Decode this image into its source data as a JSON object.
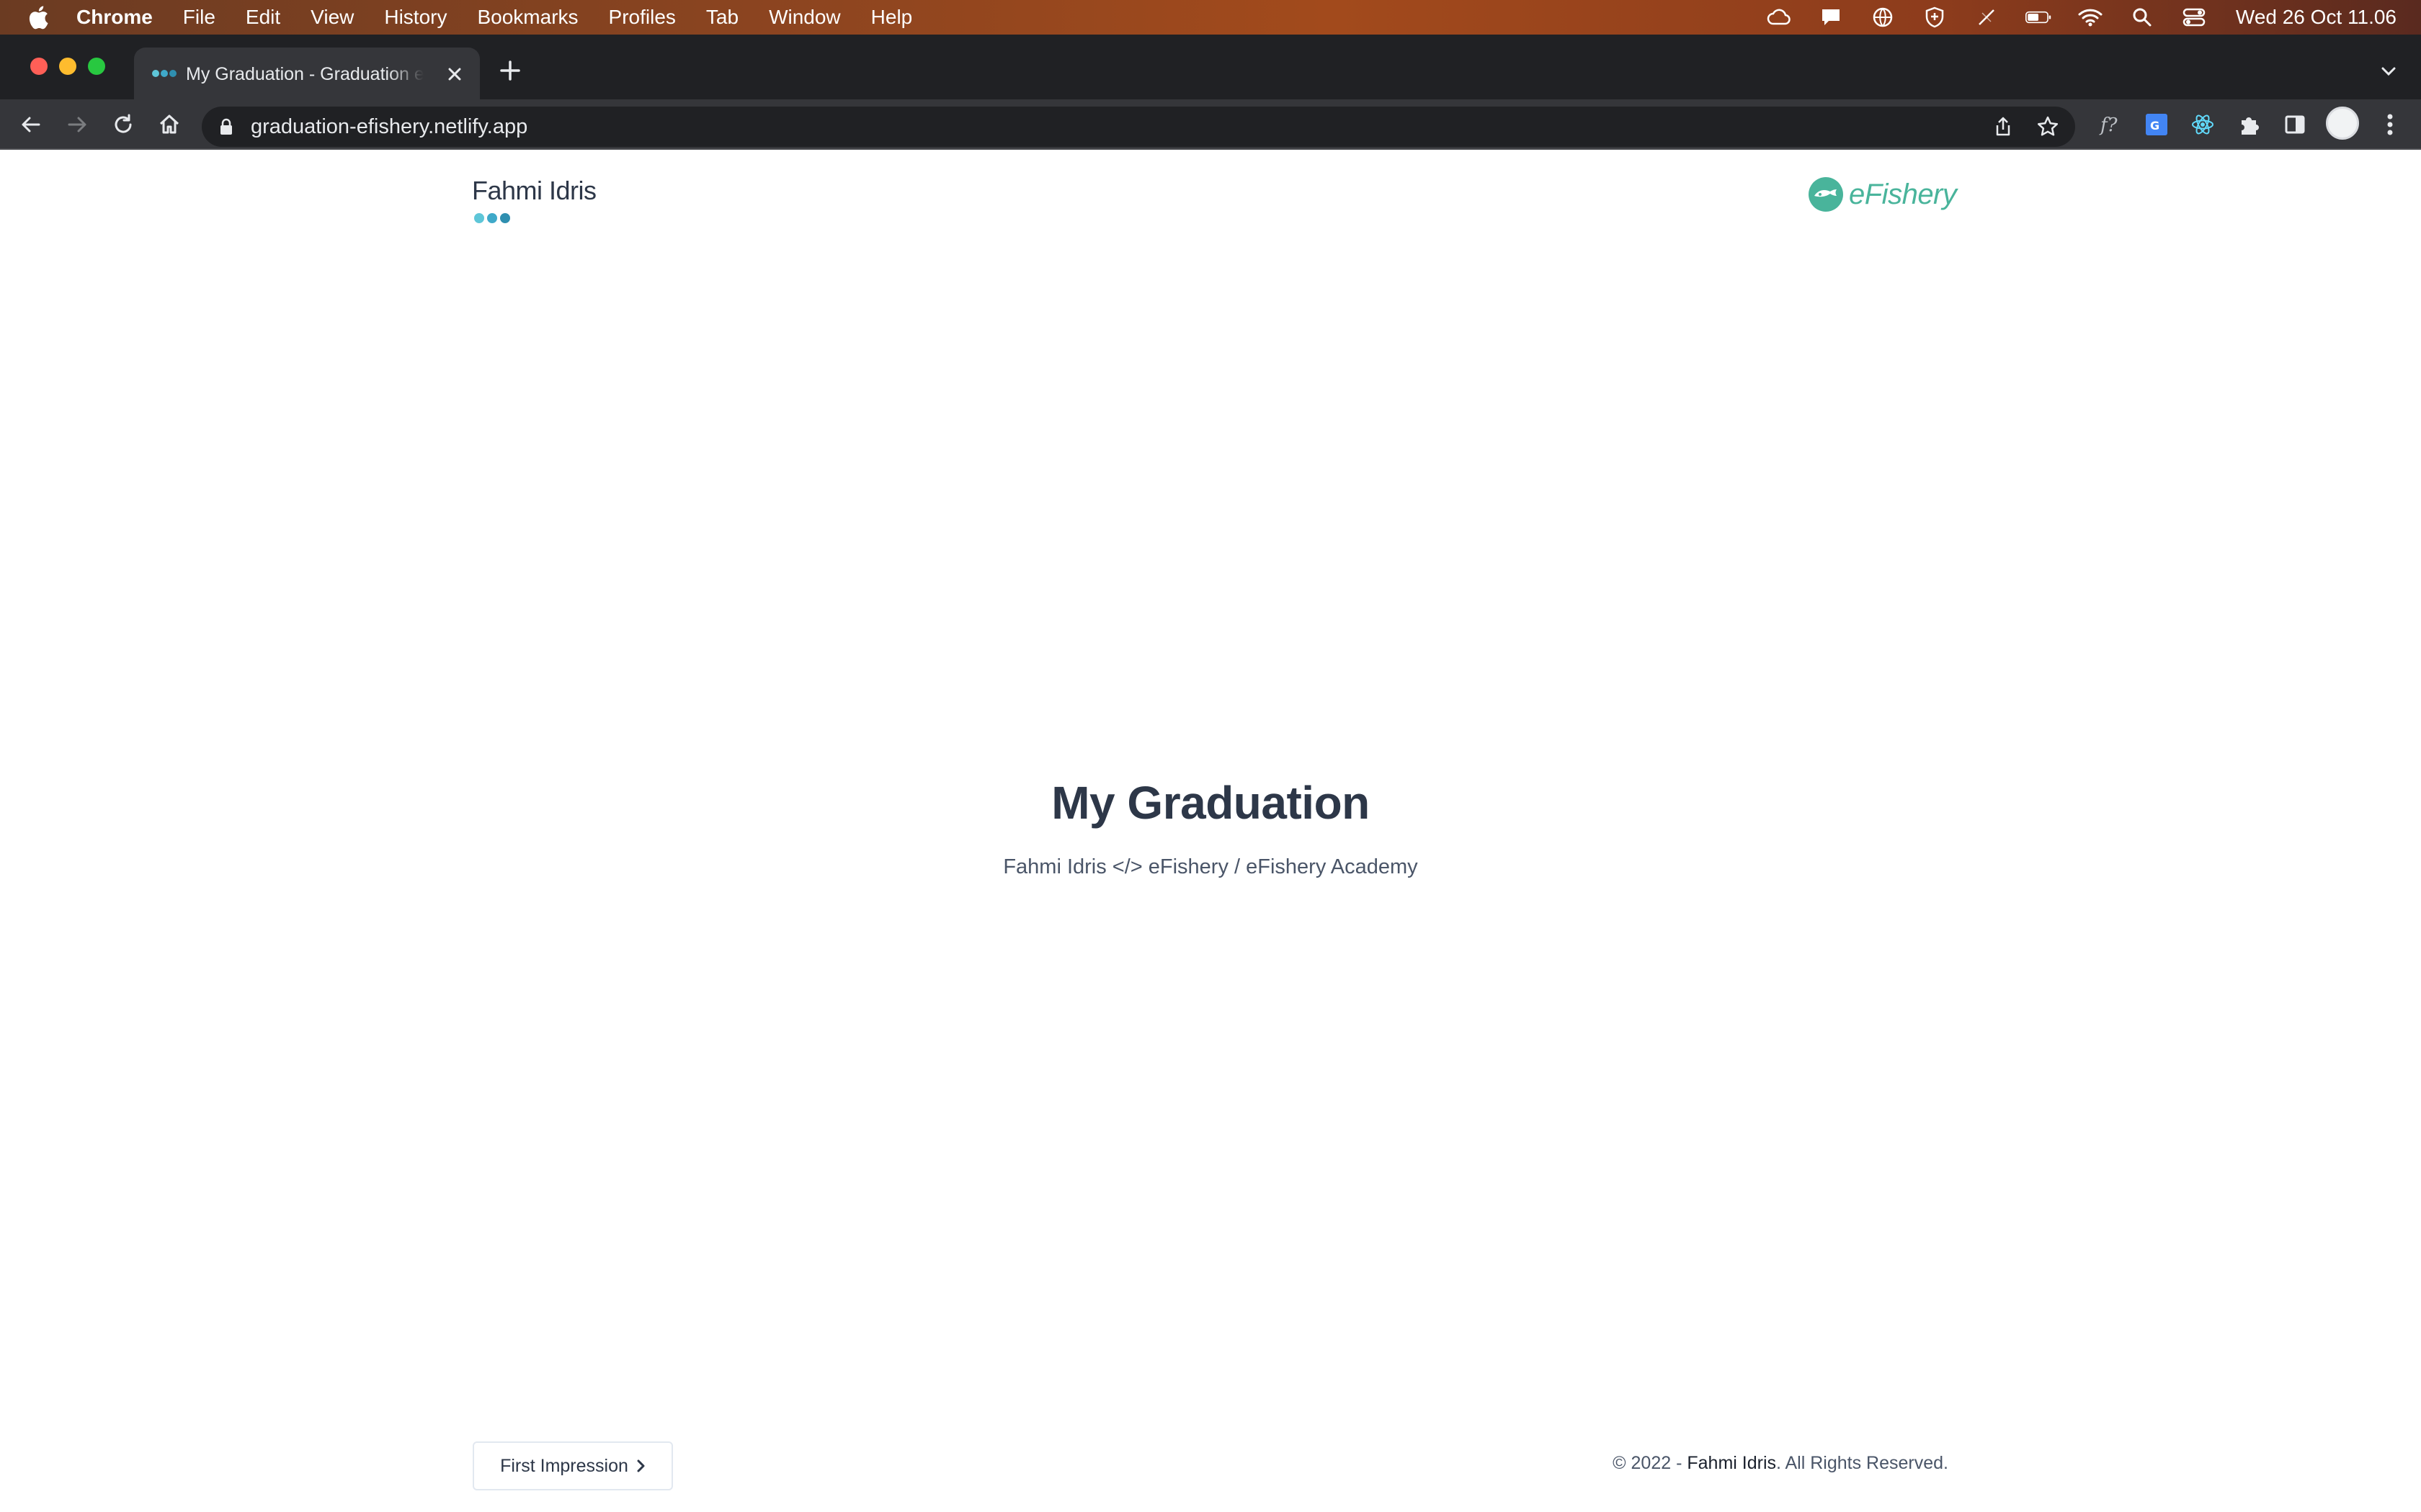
{
  "menubar": {
    "app_name": "Chrome",
    "items": [
      "File",
      "Edit",
      "View",
      "History",
      "Bookmarks",
      "Profiles",
      "Tab",
      "Window",
      "Help"
    ],
    "clock": "Wed 26 Oct  11.06",
    "status_icons": [
      "creative-cloud-icon",
      "notification-icon",
      "vpn-globe-icon",
      "shield-icon",
      "sync-off-icon",
      "battery-icon",
      "wifi-icon",
      "spotlight-search-icon",
      "control-center-icon"
    ]
  },
  "browser": {
    "tab": {
      "title": "My Graduation - Graduation eFishery"
    },
    "address_bar": {
      "url": "graduation-efishery.netlify.app"
    },
    "extensions": [
      "font-identifier-icon",
      "translate-icon",
      "react-devtools-icon",
      "extensions-puzzle-icon",
      "side-panel-icon"
    ]
  },
  "page": {
    "brand_name": "Fahmi Idris",
    "partner_logo": "eFishery",
    "hero": {
      "title": "My Graduation",
      "subtitle": "Fahmi Idris </> eFishery / eFishery Academy"
    },
    "footer": {
      "next_button_label": "First Impression",
      "copyright_prefix": "© 2022 - ",
      "copyright_owner": "Fahmi Idris",
      "copyright_suffix": ". All Rights Reserved."
    }
  },
  "colors": {
    "brand_teal": "#49b49b",
    "dot_light": "#5ec6d8",
    "dot_dark": "#2f8fb0",
    "heading": "#2d3748"
  }
}
